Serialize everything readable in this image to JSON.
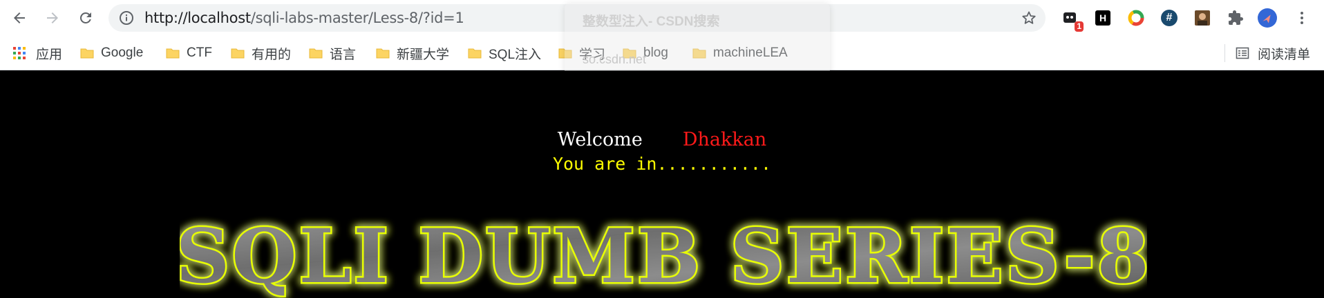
{
  "browser": {
    "url_host": "http://localhost",
    "url_path": "/sqli-labs-master/Less-8/?id=1",
    "extension_badge": "1",
    "extension_h_label": "H",
    "extension_hash_label": "#",
    "reading_list_label": "阅读清单"
  },
  "bookmarks": [
    {
      "label": "应用"
    },
    {
      "label": "Google"
    },
    {
      "label": "CTF"
    },
    {
      "label": "有用的"
    },
    {
      "label": "语言"
    },
    {
      "label": "新疆大学"
    },
    {
      "label": "SQL注入"
    },
    {
      "label": "学习"
    },
    {
      "label": "blog"
    },
    {
      "label": "machineLEA"
    }
  ],
  "suggestion_overlay": {
    "title": "整数型注入- CSDN搜索",
    "subtitle": "so.csdn.net"
  },
  "page": {
    "welcome_word": "Welcome",
    "welcome_name": "Dhakkan",
    "status": "You are in...........",
    "banner_text": "SQLI DUMB SERIES-8"
  },
  "colors": {
    "background": "#000000",
    "welcome": "#ffffff",
    "name": "#ff1a1a",
    "status": "#ffff00",
    "banner_glow": "#e8ff00"
  }
}
